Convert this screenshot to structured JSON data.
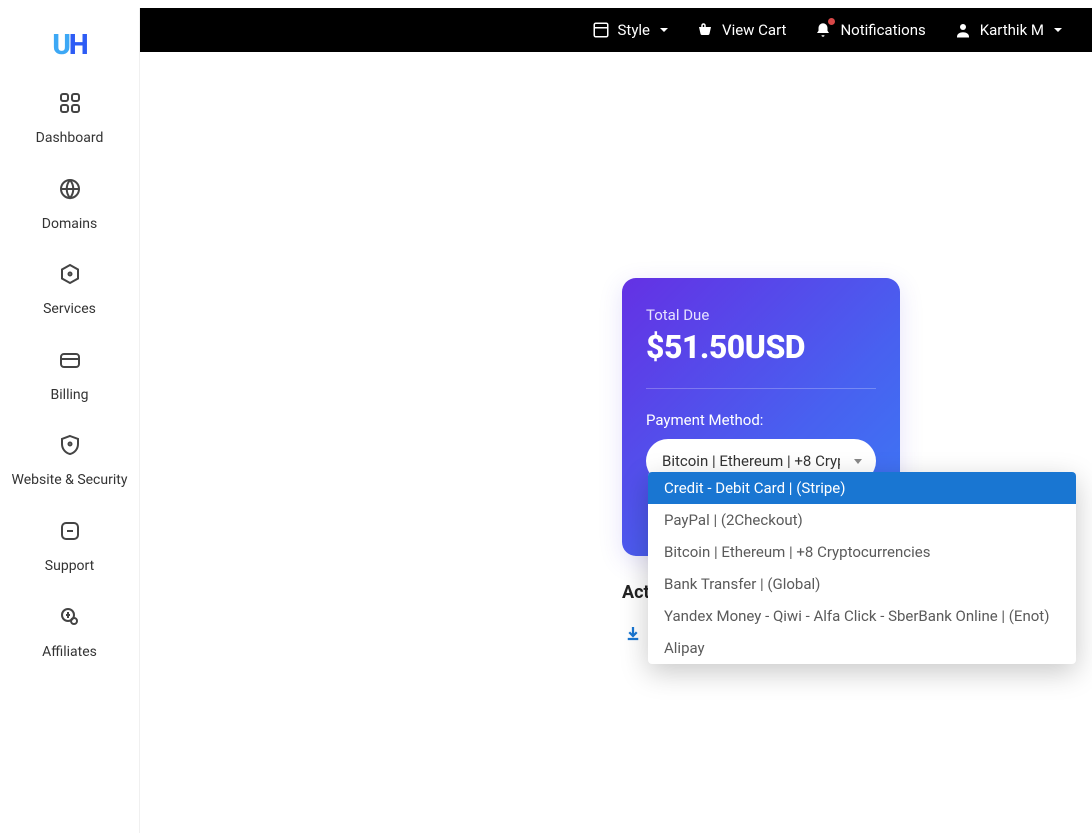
{
  "topbar": {
    "style": "Style",
    "viewcart": "View Cart",
    "notifications": "Notifications",
    "user": "Karthik M"
  },
  "sidebar": {
    "items": [
      {
        "label": "Dashboard"
      },
      {
        "label": "Domains"
      },
      {
        "label": "Services"
      },
      {
        "label": "Billing"
      },
      {
        "label": "Website & Security"
      },
      {
        "label": "Support"
      },
      {
        "label": "Affiliates"
      }
    ]
  },
  "payment": {
    "total_due_label": "Total Due",
    "amount": "$51.50USD",
    "method_label": "Payment Method:",
    "selected": "Bitcoin | Ethereum | +8 Cryp",
    "options": [
      "Credit - Debit Card | (Stripe)",
      "PayPal | (2Checkout)",
      "Bitcoin | Ethereum | +8 Cryptocurrencies",
      "Bank Transfer | (Global)",
      "Yandex Money - Qiwi - Alfa Click - SberBank Online | (Enot)",
      "Alipay"
    ]
  },
  "actions_label": "Act"
}
